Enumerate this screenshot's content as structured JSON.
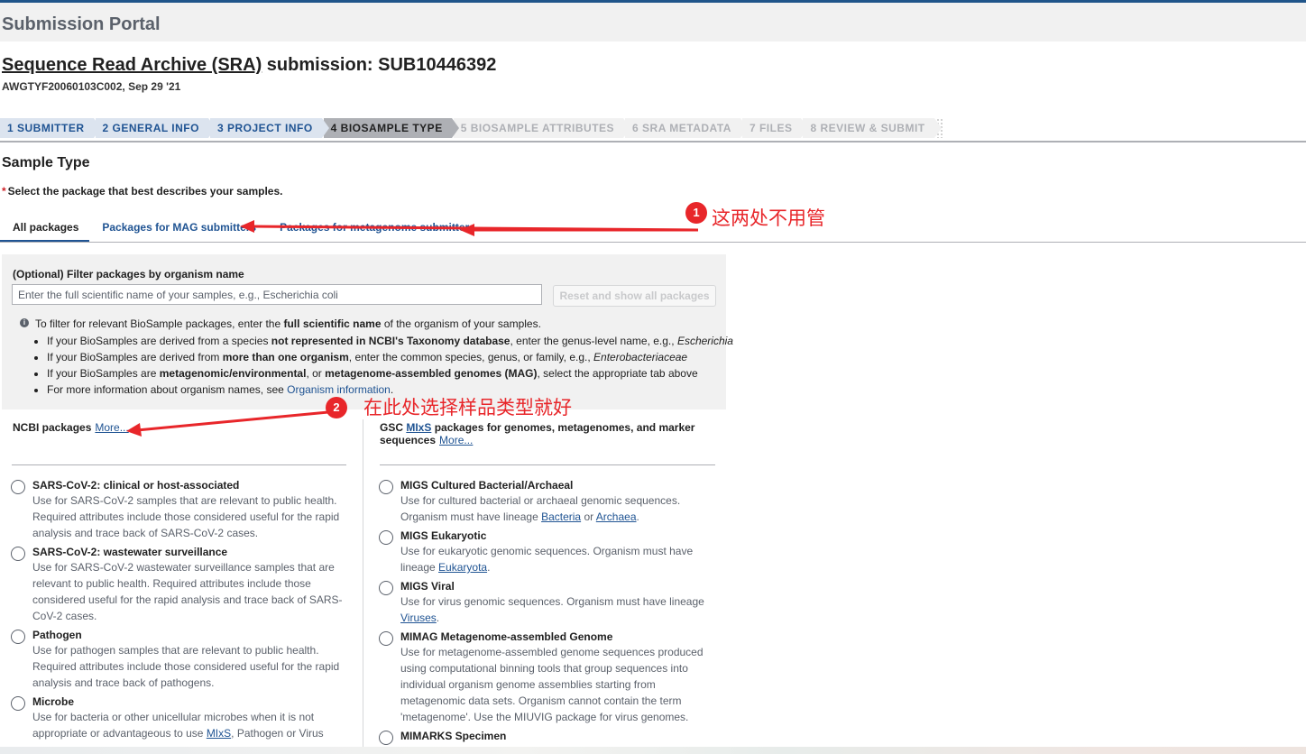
{
  "portal": {
    "title": "Submission Portal"
  },
  "submission": {
    "title_link": "Sequence Read Archive (SRA)",
    "title_rest": " submission: SUB10446392",
    "subtitle": "AWGTYF20060103C002, Sep 29 '21"
  },
  "steps": [
    {
      "label": "1 SUBMITTER",
      "state": "done"
    },
    {
      "label": "2 GENERAL INFO",
      "state": "done"
    },
    {
      "label": "3 PROJECT INFO",
      "state": "done"
    },
    {
      "label": "4 BIOSAMPLE TYPE",
      "state": "current"
    },
    {
      "label": "5 BIOSAMPLE ATTRIBUTES",
      "state": "future"
    },
    {
      "label": "6 SRA METADATA",
      "state": "future"
    },
    {
      "label": "7 FILES",
      "state": "future"
    },
    {
      "label": "8 REVIEW & SUBMIT",
      "state": "future"
    }
  ],
  "section": {
    "title": "Sample Type",
    "required_mark": "*",
    "instruction": "Select the package that best describes your samples."
  },
  "tabs": [
    {
      "label": "All packages",
      "active": true
    },
    {
      "label": "Packages for MAG submitters",
      "active": false
    },
    {
      "label": "Packages for metagenome submitters",
      "active": false
    }
  ],
  "filter": {
    "label": "(Optional) Filter packages by organism name",
    "placeholder": "Enter the full scientific name of your samples, e.g., Escherichia coli",
    "value": "",
    "reset_label": "Reset and show all packages",
    "info_prefix": "To filter for relevant BioSample packages, enter the ",
    "info_bold": "full scientific name",
    "info_suffix": " of the organism of your samples.",
    "bullets": [
      {
        "a": "If your BioSamples are derived from a species ",
        "b": "not represented in NCBI's Taxonomy database",
        "c": ", enter the genus-level name, e.g., ",
        "i": "Escherichia"
      },
      {
        "a": "If your BioSamples are derived from ",
        "b": "more than one organism",
        "c": ", enter the common species, genus, or family, e.g., ",
        "i": "Enterobacteriaceae"
      },
      {
        "a": "If your BioSamples are ",
        "b": "metagenomic/environmental",
        "c": ", or ",
        "b2": "metagenome-assembled genomes (MAG)",
        "d": ", select the appropriate tab above"
      }
    ],
    "more_info_prefix": "For more information about organism names, see ",
    "more_info_link": "Organism information",
    "more_info_suffix": "."
  },
  "ncbi": {
    "heading": "NCBI packages",
    "more": "More...",
    "packages": [
      {
        "title": "SARS-CoV-2: clinical or host-associated",
        "desc": "Use for SARS-CoV-2 samples that are relevant to public health. Required attributes include those considered useful for the rapid analysis and trace back of SARS-CoV-2 cases."
      },
      {
        "title": "SARS-CoV-2: wastewater surveillance",
        "desc": "Use for SARS-CoV-2 wastewater surveillance samples that are relevant to public health. Required attributes include those considered useful for the rapid analysis and trace back of SARS-CoV-2 cases."
      },
      {
        "title": "Pathogen",
        "desc": "Use for pathogen samples that are relevant to public health. Required attributes include those considered useful for the rapid analysis and trace back of pathogens."
      },
      {
        "title": "Microbe",
        "desc_a": "Use for bacteria or other unicellular microbes when it is not appropriate or advantageous to use ",
        "desc_link": "MIxS",
        "desc_b": ", Pathogen or Virus"
      }
    ]
  },
  "gsc": {
    "heading_a": "GSC ",
    "heading_link": "MIxS",
    "heading_b": " packages for genomes, metagenomes, and marker sequences",
    "more": "More...",
    "packages": [
      {
        "title": "MIGS Cultured Bacterial/Archaeal",
        "desc_a": "Use for cultured bacterial or archaeal genomic sequences. Organism must have lineage ",
        "link1": "Bacteria",
        "desc_b": " or ",
        "link2": "Archaea",
        "desc_c": "."
      },
      {
        "title": "MIGS Eukaryotic",
        "desc_a": "Use for eukaryotic genomic sequences. Organism must have lineage ",
        "link1": "Eukaryota",
        "desc_b": "."
      },
      {
        "title": "MIGS Viral",
        "desc_a": "Use for virus genomic sequences. Organism must have lineage ",
        "link1": "Viruses",
        "desc_b": "."
      },
      {
        "title": "MIMAG Metagenome-assembled Genome",
        "desc": "Use for metagenome-assembled genome sequences produced using computational binning tools that group sequences into individual organism genome assemblies starting from metagenomic data sets. Organism cannot contain the term 'metagenome'. Use the MIUVIG package for virus genomes."
      },
      {
        "title": "MIMARKS Specimen",
        "desc": ""
      }
    ]
  },
  "annotations": [
    {
      "number": "1",
      "text": "这两处不用管"
    },
    {
      "number": "2",
      "text": "在此处选择样品类型就好"
    }
  ],
  "colors": {
    "annotation": "#e8262a",
    "link": "#205493",
    "header_accent": "#20558a"
  }
}
